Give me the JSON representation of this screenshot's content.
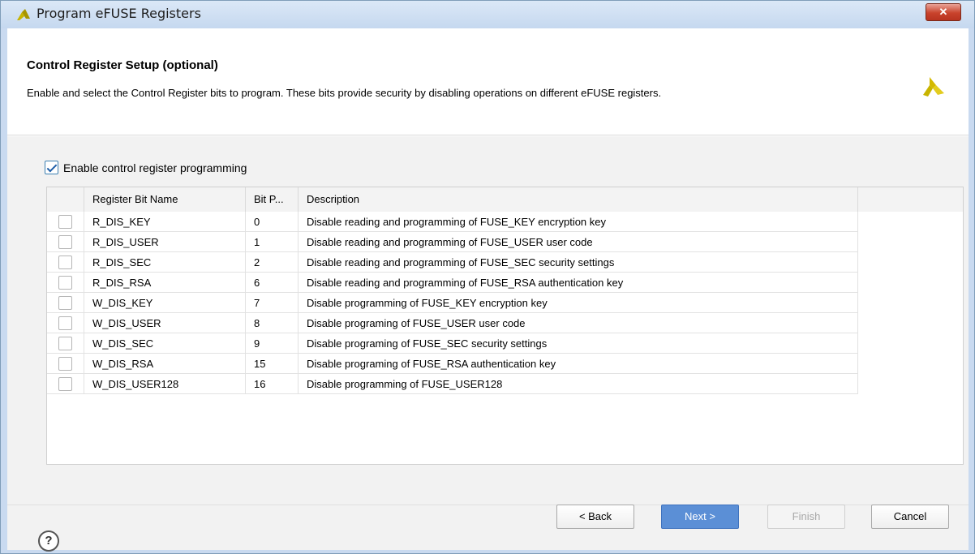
{
  "window": {
    "title": "Program eFUSE Registers",
    "close_label": "✕"
  },
  "header": {
    "title": "Control Register Setup (optional)",
    "description": "Enable and select the Control Register bits to program. These bits provide security by disabling operations on different eFUSE registers."
  },
  "enable_checkbox": {
    "label": "Enable control register programming",
    "checked": true
  },
  "table": {
    "columns": [
      "Register Bit Name",
      "Bit P...",
      "Description"
    ],
    "rows": [
      {
        "name": "R_DIS_KEY",
        "bit": "0",
        "description": "Disable reading and programming of FUSE_KEY encryption key"
      },
      {
        "name": "R_DIS_USER",
        "bit": "1",
        "description": "Disable reading and programming of FUSE_USER user code"
      },
      {
        "name": "R_DIS_SEC",
        "bit": "2",
        "description": "Disable reading and programming of FUSE_SEC security settings"
      },
      {
        "name": "R_DIS_RSA",
        "bit": "6",
        "description": "Disable reading and programming of FUSE_RSA authentication key"
      },
      {
        "name": "W_DIS_KEY",
        "bit": "7",
        "description": "Disable programming of FUSE_KEY encryption key"
      },
      {
        "name": "W_DIS_USER",
        "bit": "8",
        "description": "Disable programing of FUSE_USER user code"
      },
      {
        "name": "W_DIS_SEC",
        "bit": "9",
        "description": "Disable programing of FUSE_SEC security settings"
      },
      {
        "name": "W_DIS_RSA",
        "bit": "15",
        "description": "Disable programing of FUSE_RSA authentication key"
      },
      {
        "name": "W_DIS_USER128",
        "bit": "16",
        "description": "Disable programming of FUSE_USER128"
      }
    ]
  },
  "footer": {
    "help_label": "?",
    "back_label": "< Back",
    "next_label": "Next >",
    "finish_label": "Finish",
    "cancel_label": "Cancel"
  },
  "colors": {
    "accent": "#5b8fd6",
    "logo": "#c8b400",
    "close": "#c9432c"
  },
  "icons": [
    "xilinx-logo-icon",
    "close-icon",
    "help-icon",
    "checkbox-icon"
  ]
}
